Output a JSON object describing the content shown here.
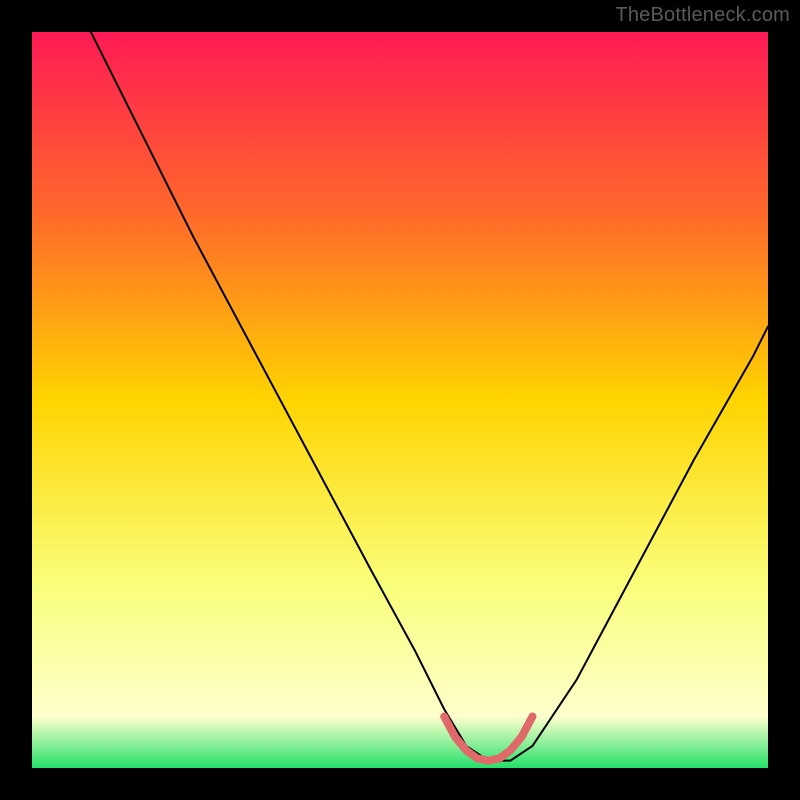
{
  "attribution": "TheBottleneck.com",
  "chart_data": {
    "type": "line",
    "title": "",
    "xlabel": "",
    "ylabel": "",
    "xlim": [
      0,
      100
    ],
    "ylim": [
      0,
      100
    ],
    "background_gradient": {
      "stops": [
        {
          "offset": 0,
          "color": "#ff1a55"
        },
        {
          "offset": 25,
          "color": "#ff6a2a"
        },
        {
          "offset": 50,
          "color": "#ffd400"
        },
        {
          "offset": 75,
          "color": "#f9ff7a"
        },
        {
          "offset": 93,
          "color": "#ffffcc"
        },
        {
          "offset": 100,
          "color": "#24e06a"
        }
      ]
    },
    "series": [
      {
        "name": "bottleneck-curve",
        "color": "#000000",
        "width": 2,
        "x": [
          8,
          15,
          22,
          30,
          38,
          46,
          52,
          56,
          59,
          62,
          65,
          68,
          74,
          82,
          90,
          98,
          100
        ],
        "y": [
          100,
          86,
          72,
          57,
          42,
          27,
          16,
          8,
          3,
          1,
          1,
          3,
          12,
          27,
          42,
          56,
          60
        ]
      },
      {
        "name": "optimal-zone-marker",
        "color": "#e06a6a",
        "width": 8,
        "x": [
          56,
          57.5,
          59,
          60.5,
          62,
          63.5,
          65,
          66.5,
          68
        ],
        "y": [
          7,
          4.2,
          2.4,
          1.3,
          1,
          1.3,
          2.4,
          4.2,
          7
        ]
      }
    ]
  }
}
